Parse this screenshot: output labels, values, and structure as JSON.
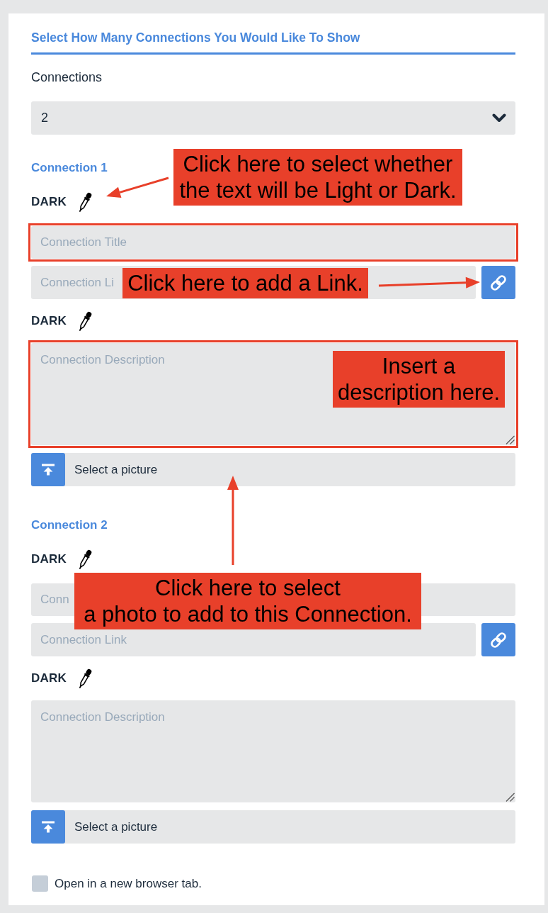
{
  "form": {
    "title": "Select How Many Connections You Would Like To Show",
    "count_label": "Connections",
    "count_select": {
      "value": "2"
    }
  },
  "connections": [
    {
      "heading": "Connection 1",
      "title_style": {
        "label": "DARK"
      },
      "title_field": {
        "placeholder": "Connection Title",
        "highlighted": true
      },
      "link_field": {
        "placeholder": "Connection Li"
      },
      "description_style": {
        "label": "DARK"
      },
      "description_field": {
        "placeholder": "Connection Description",
        "highlighted": true
      },
      "picture_picker": {
        "label": "Select a picture"
      }
    },
    {
      "heading": "Connection 2",
      "title_style": {
        "label": "DARK"
      },
      "title_field": {
        "placeholder": "Conn",
        "highlighted": false
      },
      "link_field": {
        "placeholder": "Connection Link"
      },
      "description_style": {
        "label": "DARK"
      },
      "description_field": {
        "placeholder": "Connection Description",
        "highlighted": false
      },
      "picture_picker": {
        "label": "Select a picture"
      }
    }
  ],
  "new_tab_option": {
    "label": "Open in a new browser tab.",
    "checked": false
  },
  "annotations": [
    {
      "text": "Click here to select whether\nthe text will be Light or Dark."
    },
    {
      "text": "Click here to add a Link."
    },
    {
      "text": "Insert a\ndescription here."
    },
    {
      "text": "Click here to select\na photo to add to this Connection."
    }
  ]
}
